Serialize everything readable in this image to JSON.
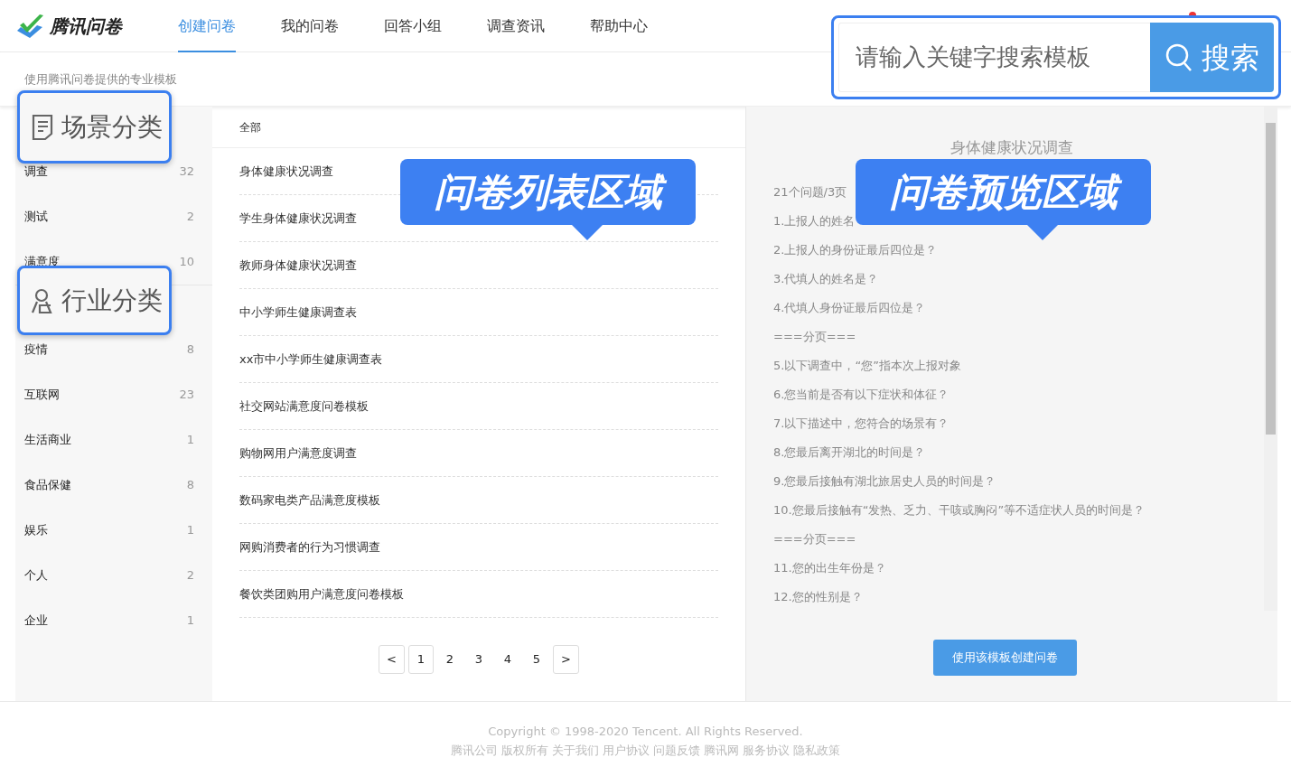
{
  "header": {
    "logo_text": "腾讯问卷",
    "nav": [
      {
        "label": "创建问卷",
        "selected": true
      },
      {
        "label": "我的问卷",
        "selected": false
      },
      {
        "label": "回答小组",
        "selected": false
      },
      {
        "label": "调查资讯",
        "selected": false
      },
      {
        "label": "帮助中心",
        "selected": false
      }
    ]
  },
  "subtitle": "使用腾讯问卷提供的专业模板",
  "sidebar": {
    "sections": [
      {
        "items": [
          {
            "label": "调查",
            "count": "32"
          },
          {
            "label": "测试",
            "count": "2"
          },
          {
            "label": "满意度",
            "count": "10"
          }
        ]
      },
      {
        "items": [
          {
            "label": "疫情",
            "count": "8"
          },
          {
            "label": "互联网",
            "count": "23"
          },
          {
            "label": "生活商业",
            "count": "1"
          },
          {
            "label": "食品保健",
            "count": "8"
          },
          {
            "label": "娱乐",
            "count": "1"
          },
          {
            "label": "个人",
            "count": "2"
          },
          {
            "label": "企业",
            "count": "1"
          }
        ]
      }
    ]
  },
  "list": {
    "filter": "全部",
    "items": [
      "身体健康状况调查",
      "学生身体健康状况调查",
      "教师身体健康状况调查",
      "中小学师生健康调查表",
      "xx市中小学师生健康调查表",
      "社交网站满意度问卷模板",
      "购物网用户满意度调查",
      "数码家电类产品满意度模板",
      "网购消费者的行为习惯调查",
      "餐饮类团购用户满意度问卷模板"
    ],
    "pagination": {
      "prev": "<",
      "pages": [
        {
          "label": "1",
          "selected": true
        },
        {
          "label": "2",
          "selected": false
        },
        {
          "label": "3",
          "selected": false
        },
        {
          "label": "4",
          "selected": false
        },
        {
          "label": "5",
          "selected": false
        }
      ],
      "next": ">"
    }
  },
  "preview": {
    "title": "身体健康状况调查",
    "summary": "21个问题/3页",
    "questions": [
      "1.上报人的姓名",
      "2.上报人的身份证最后四位是？",
      "3.代填人的姓名是？",
      "4.代填人身份证最后四位是？",
      "===分页===",
      "5.以下调查中，“您”指本次上报对象",
      "6.您当前是否有以下症状和体征？",
      "7.以下描述中，您符合的场景有？",
      "8.您最后离开湖北的时间是？",
      "9.您最后接触有湖北旅居史人员的时间是？",
      "10.您最后接触有“发热、乏力、干咳或胸闷”等不适症状人员的时间是？",
      "===分页===",
      "11.您的出生年份是？",
      "12.您的性别是？"
    ],
    "button": "使用该模板创建问卷"
  },
  "footer": {
    "copyright": "Copyright © 1998-2020 Tencent. All Rights Reserved.",
    "links": [
      "腾讯公司 版权所有",
      "关于我们",
      "用户协议",
      "问题反馈",
      "腾讯网",
      "服务协议",
      "隐私政策"
    ]
  },
  "annotations": [
    {
      "kind": "search",
      "placeholder": "请输入关键字搜索模板",
      "button": "搜索"
    },
    {
      "kind": "tag",
      "text": "场景分类"
    },
    {
      "kind": "bubble",
      "text": "问卷列表区域"
    },
    {
      "kind": "bubble",
      "text": "问卷预览区域"
    },
    {
      "kind": "tag",
      "text": "行业分类"
    }
  ]
}
